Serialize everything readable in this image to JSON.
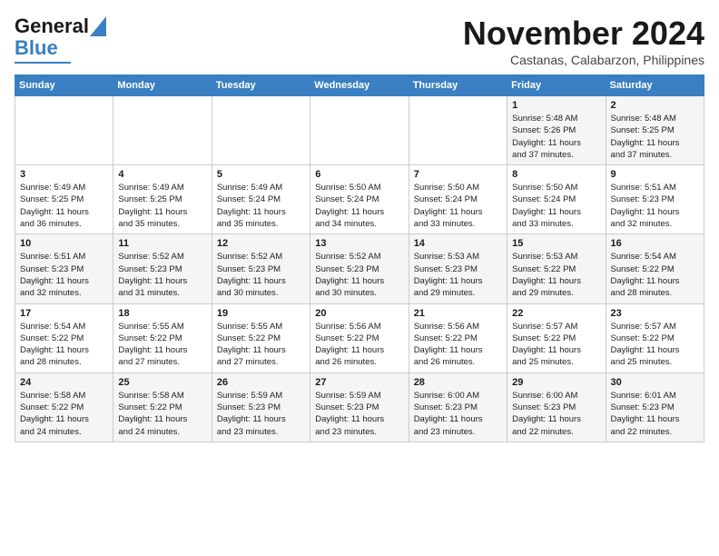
{
  "header": {
    "logo": {
      "general": "General",
      "blue": "Blue"
    },
    "title": "November 2024",
    "location": "Castanas, Calabarzon, Philippines"
  },
  "calendar": {
    "weekdays": [
      "Sunday",
      "Monday",
      "Tuesday",
      "Wednesday",
      "Thursday",
      "Friday",
      "Saturday"
    ],
    "weeks": [
      [
        {
          "day": "",
          "info": ""
        },
        {
          "day": "",
          "info": ""
        },
        {
          "day": "",
          "info": ""
        },
        {
          "day": "",
          "info": ""
        },
        {
          "day": "",
          "info": ""
        },
        {
          "day": "1",
          "info": "Sunrise: 5:48 AM\nSunset: 5:26 PM\nDaylight: 11 hours\nand 37 minutes."
        },
        {
          "day": "2",
          "info": "Sunrise: 5:48 AM\nSunset: 5:25 PM\nDaylight: 11 hours\nand 37 minutes."
        }
      ],
      [
        {
          "day": "3",
          "info": "Sunrise: 5:49 AM\nSunset: 5:25 PM\nDaylight: 11 hours\nand 36 minutes."
        },
        {
          "day": "4",
          "info": "Sunrise: 5:49 AM\nSunset: 5:25 PM\nDaylight: 11 hours\nand 35 minutes."
        },
        {
          "day": "5",
          "info": "Sunrise: 5:49 AM\nSunset: 5:24 PM\nDaylight: 11 hours\nand 35 minutes."
        },
        {
          "day": "6",
          "info": "Sunrise: 5:50 AM\nSunset: 5:24 PM\nDaylight: 11 hours\nand 34 minutes."
        },
        {
          "day": "7",
          "info": "Sunrise: 5:50 AM\nSunset: 5:24 PM\nDaylight: 11 hours\nand 33 minutes."
        },
        {
          "day": "8",
          "info": "Sunrise: 5:50 AM\nSunset: 5:24 PM\nDaylight: 11 hours\nand 33 minutes."
        },
        {
          "day": "9",
          "info": "Sunrise: 5:51 AM\nSunset: 5:23 PM\nDaylight: 11 hours\nand 32 minutes."
        }
      ],
      [
        {
          "day": "10",
          "info": "Sunrise: 5:51 AM\nSunset: 5:23 PM\nDaylight: 11 hours\nand 32 minutes."
        },
        {
          "day": "11",
          "info": "Sunrise: 5:52 AM\nSunset: 5:23 PM\nDaylight: 11 hours\nand 31 minutes."
        },
        {
          "day": "12",
          "info": "Sunrise: 5:52 AM\nSunset: 5:23 PM\nDaylight: 11 hours\nand 30 minutes."
        },
        {
          "day": "13",
          "info": "Sunrise: 5:52 AM\nSunset: 5:23 PM\nDaylight: 11 hours\nand 30 minutes."
        },
        {
          "day": "14",
          "info": "Sunrise: 5:53 AM\nSunset: 5:23 PM\nDaylight: 11 hours\nand 29 minutes."
        },
        {
          "day": "15",
          "info": "Sunrise: 5:53 AM\nSunset: 5:22 PM\nDaylight: 11 hours\nand 29 minutes."
        },
        {
          "day": "16",
          "info": "Sunrise: 5:54 AM\nSunset: 5:22 PM\nDaylight: 11 hours\nand 28 minutes."
        }
      ],
      [
        {
          "day": "17",
          "info": "Sunrise: 5:54 AM\nSunset: 5:22 PM\nDaylight: 11 hours\nand 28 minutes."
        },
        {
          "day": "18",
          "info": "Sunrise: 5:55 AM\nSunset: 5:22 PM\nDaylight: 11 hours\nand 27 minutes."
        },
        {
          "day": "19",
          "info": "Sunrise: 5:55 AM\nSunset: 5:22 PM\nDaylight: 11 hours\nand 27 minutes."
        },
        {
          "day": "20",
          "info": "Sunrise: 5:56 AM\nSunset: 5:22 PM\nDaylight: 11 hours\nand 26 minutes."
        },
        {
          "day": "21",
          "info": "Sunrise: 5:56 AM\nSunset: 5:22 PM\nDaylight: 11 hours\nand 26 minutes."
        },
        {
          "day": "22",
          "info": "Sunrise: 5:57 AM\nSunset: 5:22 PM\nDaylight: 11 hours\nand 25 minutes."
        },
        {
          "day": "23",
          "info": "Sunrise: 5:57 AM\nSunset: 5:22 PM\nDaylight: 11 hours\nand 25 minutes."
        }
      ],
      [
        {
          "day": "24",
          "info": "Sunrise: 5:58 AM\nSunset: 5:22 PM\nDaylight: 11 hours\nand 24 minutes."
        },
        {
          "day": "25",
          "info": "Sunrise: 5:58 AM\nSunset: 5:22 PM\nDaylight: 11 hours\nand 24 minutes."
        },
        {
          "day": "26",
          "info": "Sunrise: 5:59 AM\nSunset: 5:23 PM\nDaylight: 11 hours\nand 23 minutes."
        },
        {
          "day": "27",
          "info": "Sunrise: 5:59 AM\nSunset: 5:23 PM\nDaylight: 11 hours\nand 23 minutes."
        },
        {
          "day": "28",
          "info": "Sunrise: 6:00 AM\nSunset: 5:23 PM\nDaylight: 11 hours\nand 23 minutes."
        },
        {
          "day": "29",
          "info": "Sunrise: 6:00 AM\nSunset: 5:23 PM\nDaylight: 11 hours\nand 22 minutes."
        },
        {
          "day": "30",
          "info": "Sunrise: 6:01 AM\nSunset: 5:23 PM\nDaylight: 11 hours\nand 22 minutes."
        }
      ]
    ]
  }
}
